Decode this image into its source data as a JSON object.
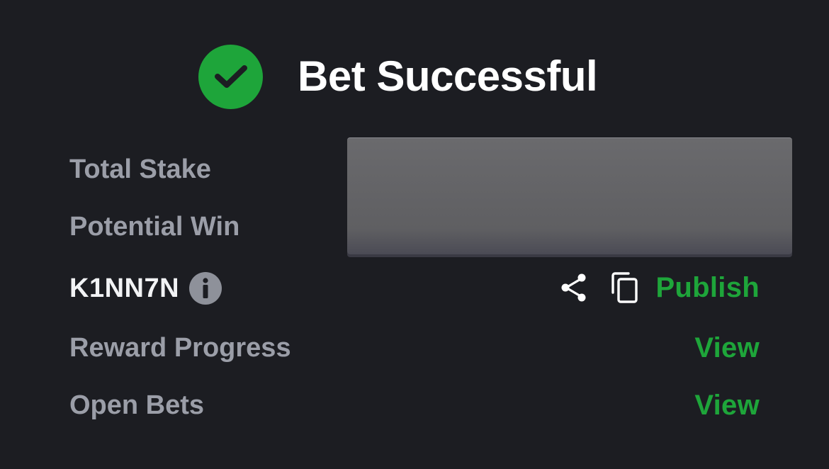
{
  "header": {
    "title": "Bet Successful",
    "icon": "check-circle-icon"
  },
  "rows": {
    "total_stake_label": "Total Stake",
    "potential_win_label": "Potential Win",
    "bet_code": "K1NN7N",
    "reward_progress_label": "Reward Progress",
    "open_bets_label": "Open Bets"
  },
  "actions": {
    "publish_label": "Publish",
    "reward_view_label": "View",
    "open_bets_view_label": "View"
  },
  "icons": {
    "info": "info-icon",
    "share": "share-icon",
    "copy": "copy-icon"
  },
  "colors": {
    "background": "#1c1d22",
    "accent_green": "#1ea53a",
    "label_gray": "#9b9ea8",
    "text_white": "#ffffff"
  }
}
